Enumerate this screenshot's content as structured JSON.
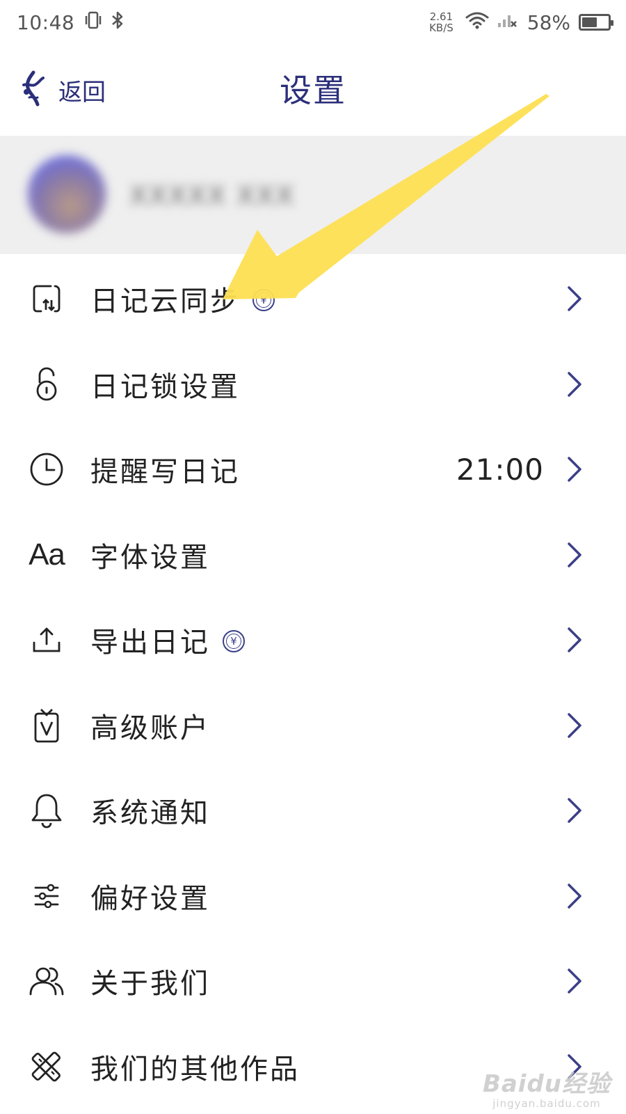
{
  "status_bar": {
    "time": "10:48",
    "icons": [
      "vibrate-icon",
      "bluetooth-icon",
      "wifi-icon",
      "signal-icon"
    ],
    "net_speed_value": "2.61",
    "net_speed_unit": "KB/S",
    "battery_percent": "58%",
    "battery_level": 0.58
  },
  "nav": {
    "back_label": "返回",
    "title": "设置",
    "title_color": "#2b2f7a"
  },
  "profile": {
    "avatar": "avatar",
    "name_blurred": "XXXXX XXX"
  },
  "settings": [
    {
      "icon": "cloud-sync-icon",
      "label": "日记云同步",
      "vip": true,
      "vip_symbol": "¥",
      "value": ""
    },
    {
      "icon": "unlock-icon",
      "label": "日记锁设置",
      "vip": false,
      "value": ""
    },
    {
      "icon": "clock-icon",
      "label": "提醒写日记",
      "vip": false,
      "value": "21:00"
    },
    {
      "icon": "font-icon",
      "icon_text": "Aa",
      "label": "字体设置",
      "vip": false,
      "value": ""
    },
    {
      "icon": "export-icon",
      "label": "导出日记",
      "vip": true,
      "vip_symbol": "¥",
      "value": ""
    },
    {
      "icon": "premium-badge-icon",
      "label": "高级账户",
      "vip": false,
      "value": ""
    },
    {
      "icon": "bell-icon",
      "label": "系统通知",
      "vip": false,
      "value": ""
    },
    {
      "icon": "sliders-icon",
      "label": "偏好设置",
      "vip": false,
      "value": ""
    },
    {
      "icon": "users-icon",
      "label": "关于我们",
      "vip": false,
      "value": ""
    },
    {
      "icon": "tools-icon",
      "label": "我们的其他作品",
      "vip": false,
      "value": ""
    }
  ],
  "annotation": {
    "color": "#fddf52"
  },
  "watermark": {
    "main": "Baidu经验",
    "sub": "jingyan.baidu.com"
  },
  "colors": {
    "accent": "#2b2f7a",
    "chevron": "#3a3f86",
    "profile_bg": "#efefef"
  }
}
